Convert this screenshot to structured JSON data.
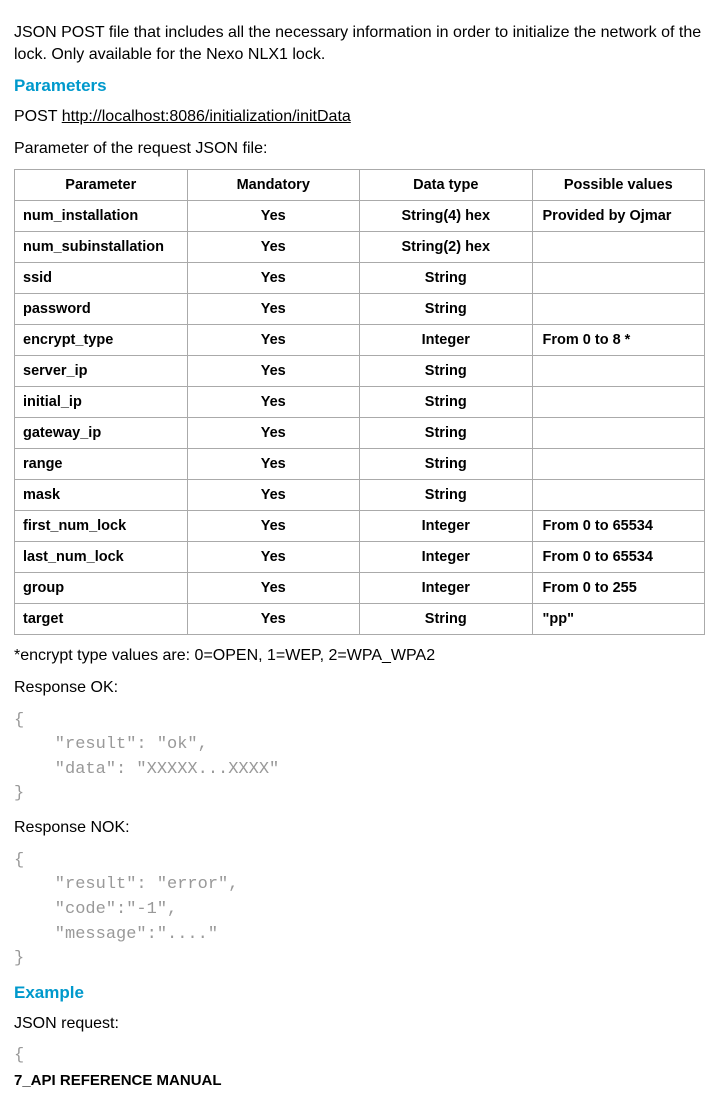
{
  "intro": "JSON POST file that includes all the necessary information in order to initialize the network of the lock. Only available for the Nexo NLX1 lock.",
  "heading_parameters": "Parameters",
  "post_prefix": "POST ",
  "post_url": "http://localhost:8086/initialization/initData",
  "param_line": "Parameter of the request JSON file:",
  "table": {
    "headers": [
      "Parameter",
      "Mandatory",
      "Data type",
      "Possible values"
    ],
    "rows": [
      [
        "num_installation",
        "Yes",
        "String(4) hex",
        "Provided by Ojmar"
      ],
      [
        "num_subinstallation",
        "Yes",
        "String(2) hex",
        ""
      ],
      [
        " ssid",
        "Yes",
        "String",
        ""
      ],
      [
        "password",
        "Yes",
        "String",
        ""
      ],
      [
        "encrypt_type",
        "Yes",
        "Integer",
        "From 0 to 8 *"
      ],
      [
        "server_ip",
        "Yes",
        "String",
        ""
      ],
      [
        "initial_ip",
        "Yes",
        "String",
        ""
      ],
      [
        "gateway_ip",
        "Yes",
        "String",
        ""
      ],
      [
        "range",
        "Yes",
        "String",
        ""
      ],
      [
        "mask",
        "Yes",
        "String",
        ""
      ],
      [
        "first_num_lock",
        "Yes",
        "Integer",
        "From 0 to 65534"
      ],
      [
        "last_num_lock",
        "Yes",
        "Integer",
        "From 0 to 65534"
      ],
      [
        "group",
        "Yes",
        "Integer",
        "From 0 to 255"
      ],
      [
        "target",
        "Yes",
        "String",
        " \"pp\""
      ]
    ]
  },
  "encrypt_note": "*encrypt type values are: 0=OPEN, 1=WEP, 2=WPA_WPA2",
  "response_ok_label": "Response OK:",
  "response_ok_code": "{\n    \"result\": \"ok\",\n    \"data\": \"XXXXX...XXXX\"\n}",
  "response_nok_label": "Response NOK:",
  "response_nok_code": "{\n    \"result\": \"error\",\n    \"code\":\"-1\",\n    \"message\":\"....\"\n}",
  "heading_example": "Example",
  "json_request_label": "JSON request:",
  "json_request_code": "{",
  "footer": "7_API REFERENCE MANUAL"
}
